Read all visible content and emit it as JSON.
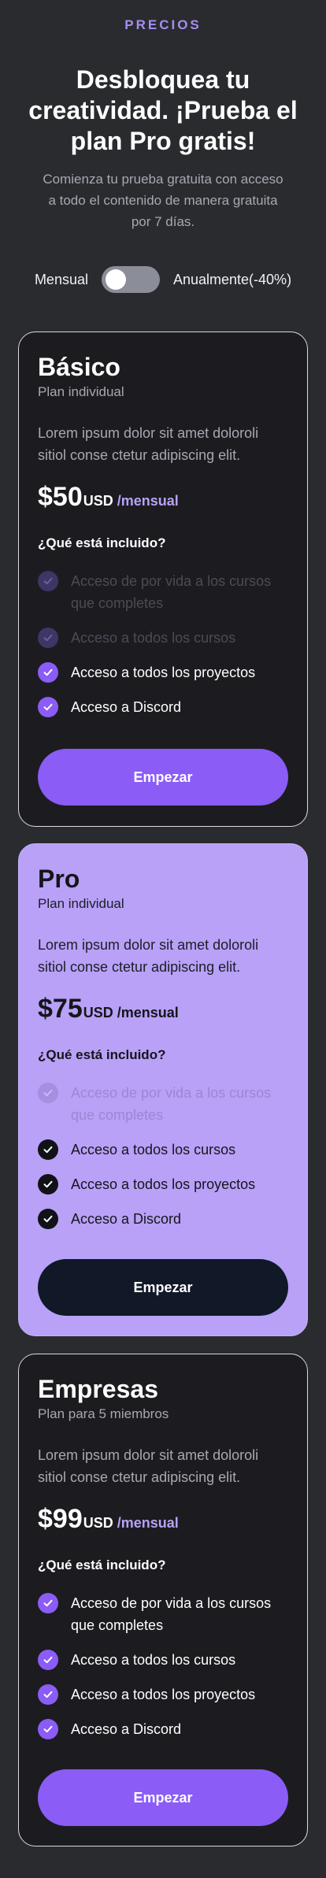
{
  "header": {
    "eyebrow": "PRECIOS",
    "title": "Desbloquea tu creatividad. ¡Prueba el plan Pro gratis!",
    "subtitle": "Comienza tu prueba gratuita con acceso a todo el contenido de manera gratuita por 7 días."
  },
  "billing_toggle": {
    "monthly_label": "Mensual",
    "annual_label": "Anualmente(-40%)",
    "state": "monthly"
  },
  "plans": [
    {
      "name": "Básico",
      "subtitle": "Plan individual",
      "description": "Lorem ipsum dolor sit amet doloroli sitiol conse ctetur adipiscing elit.",
      "price": "$50",
      "currency": "USD",
      "period": "/mensual",
      "included_label": "¿Qué está incluido?",
      "features": [
        {
          "text": "Acceso de por vida a los cursos que completes",
          "enabled": false
        },
        {
          "text": "Acceso a todos los cursos",
          "enabled": false
        },
        {
          "text": "Acceso a todos los proyectos",
          "enabled": true
        },
        {
          "text": "Acceso a Discord",
          "enabled": true
        }
      ],
      "cta": "Empezar"
    },
    {
      "name": "Pro",
      "subtitle": "Plan individual",
      "description": "Lorem ipsum dolor sit amet doloroli sitiol conse ctetur adipiscing elit.",
      "price": "$75",
      "currency": "USD",
      "period": "/mensual",
      "included_label": "¿Qué está incluido?",
      "features": [
        {
          "text": "Acceso de por vida a los cursos que completes",
          "enabled": false
        },
        {
          "text": "Acceso a todos los cursos",
          "enabled": true
        },
        {
          "text": "Acceso a todos los proyectos",
          "enabled": true
        },
        {
          "text": "Acceso a Discord",
          "enabled": true
        }
      ],
      "cta": "Empezar"
    },
    {
      "name": "Empresas",
      "subtitle": "Plan para 5 miembros",
      "description": "Lorem ipsum dolor sit amet doloroli sitiol conse ctetur adipiscing elit.",
      "price": "$99",
      "currency": "USD",
      "period": "/mensual",
      "included_label": "¿Qué está incluido?",
      "features": [
        {
          "text": "Acceso de por vida a los cursos que completes",
          "enabled": true
        },
        {
          "text": "Acceso a todos los cursos",
          "enabled": true
        },
        {
          "text": "Acceso a todos los proyectos",
          "enabled": true
        },
        {
          "text": "Acceso a Discord",
          "enabled": true
        }
      ],
      "cta": "Empezar"
    }
  ],
  "colors": {
    "background": "#2a2b2f",
    "accent": "#8b5cf6",
    "featured_card": "#b8a1f7",
    "card": "#1c1c20"
  },
  "icons": {
    "feature": "check-circle-icon",
    "toggle": "toggle-switch"
  }
}
